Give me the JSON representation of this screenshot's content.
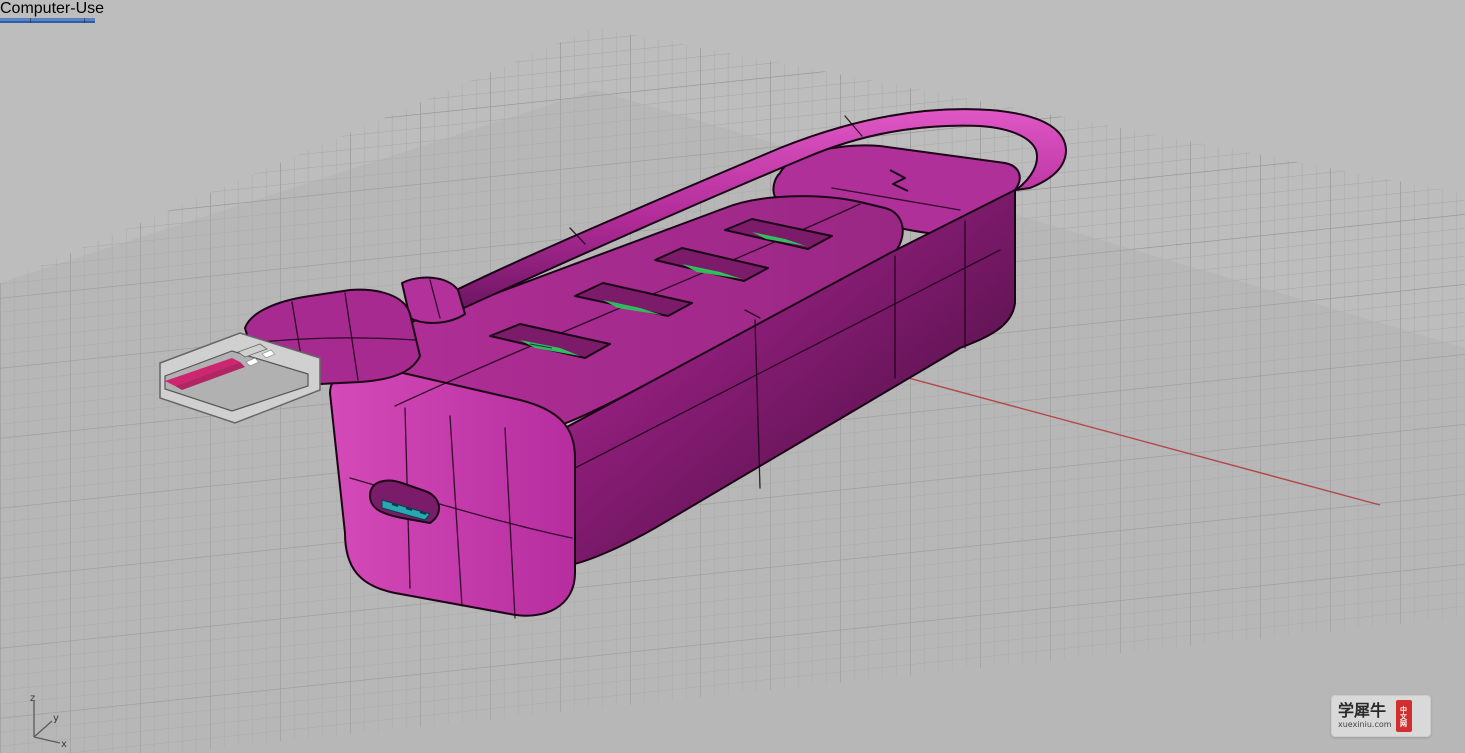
{
  "app": {
    "viewport_tab": ""
  },
  "axes": {
    "z": "z",
    "y": "y",
    "x": "x"
  },
  "watermark": {
    "title": "学犀牛",
    "subtitle": "xuexiniu.com",
    "badge": "中文网"
  },
  "colors": {
    "background": "#bdbdbd",
    "grid_minor": "#a6a6a6",
    "grid_major": "#8f8f8f",
    "x_axis": "#b33b3b",
    "model_magenta": "#b0309a",
    "model_outline": "#1b0416",
    "usb_green": "#2fd05f",
    "usb_teal": "#28a8b4",
    "metal": "#d0d0d0"
  },
  "icons": {
    "bluetooth": "bluetooth-symbol-icon"
  }
}
